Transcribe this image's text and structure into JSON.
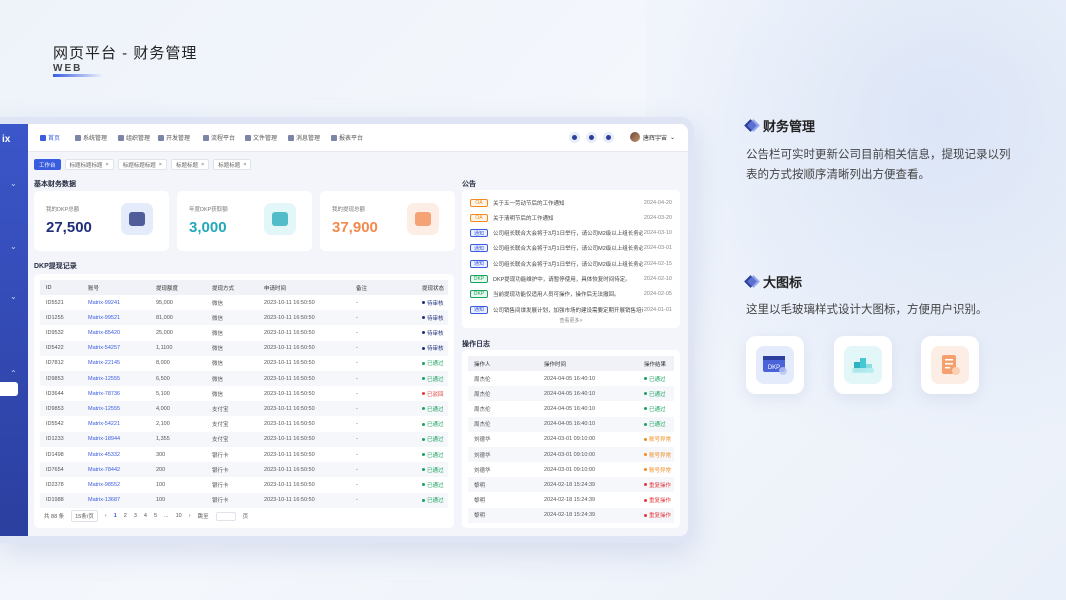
{
  "header": {
    "title": "网页平台 - 财务管理",
    "subtitle": "WEB"
  },
  "sidebar": {
    "logo": "ix"
  },
  "topbar": {
    "nav": [
      {
        "label": "首页",
        "active": true
      },
      {
        "label": "系统管理"
      },
      {
        "label": "组织管理"
      },
      {
        "label": "开发管理"
      },
      {
        "label": "流程平台"
      },
      {
        "label": "文件管理"
      },
      {
        "label": "消息管理"
      },
      {
        "label": "报表平台"
      }
    ],
    "user": "唐辉宇宙"
  },
  "tabs": [
    {
      "label": "工作台",
      "active": true
    },
    {
      "label": "标题标题标题"
    },
    {
      "label": "标题标题标题"
    },
    {
      "label": "标题标题"
    },
    {
      "label": "标题标题"
    }
  ],
  "basic": {
    "title": "基本财务数据",
    "stats": [
      {
        "label": "我的DKP总额",
        "value": "27,500",
        "color": "#1f2e7a",
        "icon": "dkp-card-icon",
        "bg": "#e4ebfb"
      },
      {
        "label": "年度DKP获取额",
        "value": "3,000",
        "color": "#22a8b8",
        "icon": "blocks-icon",
        "bg": "#e3f6f8"
      },
      {
        "label": "我的提现总额",
        "value": "37,900",
        "color": "#f28a4e",
        "icon": "document-icon",
        "bg": "#fdeee5"
      }
    ]
  },
  "records": {
    "title": "DKP提现记录",
    "columns": [
      "ID",
      "账号",
      "提现额度",
      "提现方式",
      "申请时间",
      "备注",
      "提现状态"
    ],
    "rows": [
      [
        "ID5521",
        "Matrix-99241",
        "95,000",
        "微信",
        "2023-10-11 16:50:50",
        "-",
        "待审核"
      ],
      [
        "ID1255",
        "Matrix-99521",
        "81,000",
        "微信",
        "2023-10-11 16:50:50",
        "-",
        "待审核"
      ],
      [
        "ID9532",
        "Matrix-85420",
        "25,000",
        "微信",
        "2023-10-11 16:50:50",
        "-",
        "待审核"
      ],
      [
        "ID5422",
        "Matrix-54257",
        "1,1100",
        "微信",
        "2023-10-11 16:50:50",
        "-",
        "待审核"
      ],
      [
        "ID7812",
        "Matrix-22145",
        "8,000",
        "微信",
        "2023-10-11 16:50:50",
        "-",
        "已通过"
      ],
      [
        "ID9853",
        "Matrix-12555",
        "6,500",
        "微信",
        "2023-10-11 16:50:50",
        "-",
        "已通过"
      ],
      [
        "ID3644",
        "Matrix-78736",
        "5,100",
        "微信",
        "2023-10-11 16:50:50",
        "-",
        "已驳回"
      ],
      [
        "ID9853",
        "Matrix-12555",
        "4,000",
        "支付宝",
        "2023-10-11 16:50:50",
        "-",
        "已通过"
      ],
      [
        "ID5542",
        "Matrix-54221",
        "2,100",
        "支付宝",
        "2023-10-11 16:50:50",
        "-",
        "已通过"
      ],
      [
        "ID1233",
        "Matrix-18944",
        "1,355",
        "支付宝",
        "2023-10-11 16:50:50",
        "-",
        "已通过"
      ],
      [
        "ID1498",
        "Matrix-45332",
        "300",
        "银行卡",
        "2023-10-11 16:50:50",
        "-",
        "已通过"
      ],
      [
        "ID7654",
        "Matrix-78442",
        "200",
        "银行卡",
        "2023-10-11 16:50:50",
        "-",
        "已通过"
      ],
      [
        "ID2378",
        "Matrix-98552",
        "100",
        "银行卡",
        "2023-10-11 16:50:50",
        "-",
        "已通过"
      ],
      [
        "ID1988",
        "Matrix-13687",
        "100",
        "银行卡",
        "2023-10-11 16:50:50",
        "-",
        "已通过"
      ]
    ],
    "pagination": {
      "total": "共 88 条",
      "per_page": "15条/页",
      "pages": [
        "1",
        "2",
        "3",
        "4",
        "5",
        "...",
        "10"
      ],
      "current": "1",
      "jump": "跳至",
      "page_unit": "页"
    }
  },
  "notice": {
    "title": "公告",
    "items": [
      {
        "tag": "OA",
        "title": "关于五一劳动节后的工作通知",
        "date": "2024-04-20"
      },
      {
        "tag": "OA",
        "title": "关于清明节后的工作通知",
        "date": "2024-03-20"
      },
      {
        "tag": "通知",
        "title": "公司组长联合大会将于3月1日举行，请公司M2级以上组长务必参加",
        "date": "2024-03-10"
      },
      {
        "tag": "通知",
        "title": "公司组长联合大会将于3月1日举行，请公司M2级以上组长务必参加",
        "date": "2024-03-01"
      },
      {
        "tag": "通知",
        "title": "公司组长联合大会将于3月1日举行，请公司M2级以上组长务必参加",
        "date": "2024-02-15"
      },
      {
        "tag": "DKP",
        "title": "DKP提现功能维护中，请暂停使用，具体恢复时间待定。",
        "date": "2024-02-10"
      },
      {
        "tag": "DKP",
        "title": "当前提现功能仅适用人员可操作，操作后无法撤回。",
        "date": "2024-02-05"
      },
      {
        "tag": "通知",
        "title": "公司销售间谍发展计划，加强市场的建设需要定期开展销售培训",
        "date": "2024-01-01"
      }
    ],
    "more": "查看更多>"
  },
  "log": {
    "title": "操作日志",
    "columns": [
      "操作人",
      "操作时间",
      "操作结果"
    ],
    "rows": [
      [
        "周杰伦",
        "2024-04-05 16:40:10",
        "已通过"
      ],
      [
        "周杰伦",
        "2024-04-05 16:40:10",
        "已通过"
      ],
      [
        "周杰伦",
        "2024-04-05 16:40:10",
        "已通过"
      ],
      [
        "周杰伦",
        "2024-04-05 16:40:10",
        "已通过"
      ],
      [
        "刘德华",
        "2024-03-01 09:10:00",
        "账号异常"
      ],
      [
        "刘德华",
        "2024-03-01 09:10:00",
        "账号异常"
      ],
      [
        "刘德华",
        "2024-03-01 09:10:00",
        "账号异常"
      ],
      [
        "黎明",
        "2024-02-18 15:24:39",
        "重复操作"
      ],
      [
        "黎明",
        "2024-02-18 15:24:39",
        "重复操作"
      ],
      [
        "黎明",
        "2024-02-18 15:24:39",
        "重复操作"
      ]
    ]
  },
  "panel": {
    "feature1_title": "财务管理",
    "feature1_text": "公告栏可实时更新公司目前相关信息，提现记录以列表的方式按顺序清晰列出方便查看。",
    "feature2_title": "大图标",
    "feature2_text": "这里以毛玻璃样式设计大图标，方便用户识别。",
    "dkp_text": "DKP"
  },
  "colors": {
    "primary": "#3a5de0",
    "pending": "#1f2e7a",
    "passed": "#1aa260",
    "rejected": "#e23b3b",
    "warning": "#f28a1e"
  }
}
